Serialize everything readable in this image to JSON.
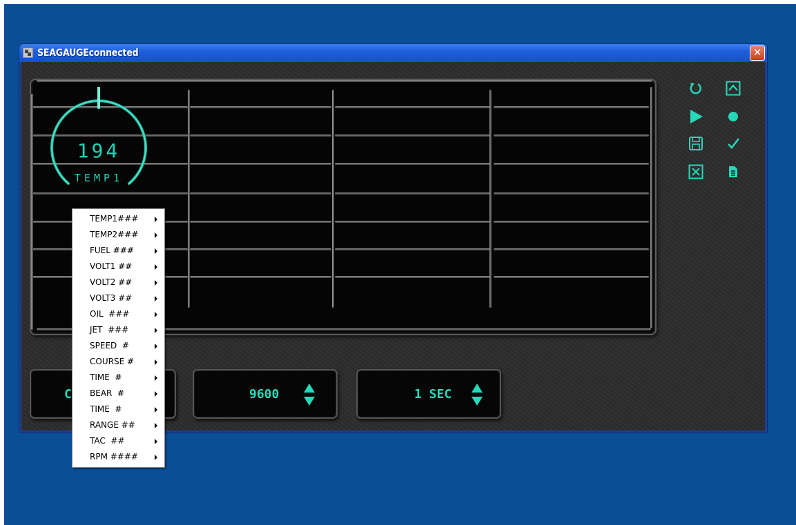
{
  "window": {
    "title": "SEAGAUGEconnected",
    "close_symbol": "✕"
  },
  "gauge": {
    "value": "194",
    "label": "TEMP1",
    "color": "#20d4b8"
  },
  "controls": {
    "icons": [
      "refresh-icon",
      "collapse-up-icon",
      "play-icon",
      "record-icon",
      "save-icon",
      "check-icon",
      "close-box-icon",
      "document-icon"
    ]
  },
  "panels": {
    "baud_rate": "9600",
    "interval": "1 SEC"
  },
  "context_menu": {
    "items": [
      "TEMP1###",
      "TEMP2###",
      "FUEL ###",
      "VOLT1 ##",
      "VOLT2 ##",
      "VOLT3 ##",
      "OIL  ###",
      "JET  ###",
      "SPEED  #",
      "COURSE #",
      "TIME  #",
      "BEAR  #",
      "TIME  #",
      "RANGE ##",
      "TAC  ##",
      "RPM ####"
    ]
  },
  "colors": {
    "accent": "#27d8b9",
    "desktop": "#0a4f96",
    "titlebar": "#1f5fdc",
    "close_button": "#c8401f"
  }
}
